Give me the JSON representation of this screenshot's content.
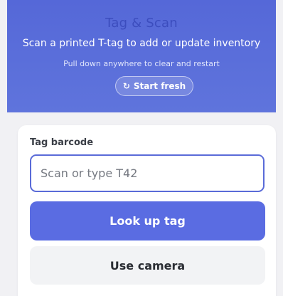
{
  "header": {
    "title": "Tag & Scan",
    "subtitle": "Scan a printed T-tag to add or update inventory",
    "hint": "Pull down anywhere to clear and restart",
    "start_button": {
      "icon": "↻",
      "label": "Start fresh"
    }
  },
  "form": {
    "barcode_label": "Tag barcode",
    "barcode_value": "",
    "barcode_placeholder": "Scan or type T42",
    "lookup_label": "Look up tag",
    "camera_label": "Use camera"
  },
  "colors": {
    "header_bg": "#5a6ce2",
    "primary_button": "#5a6ce2",
    "secondary_button": "#f2f3f5",
    "page_bg": "#f1f1f4"
  }
}
